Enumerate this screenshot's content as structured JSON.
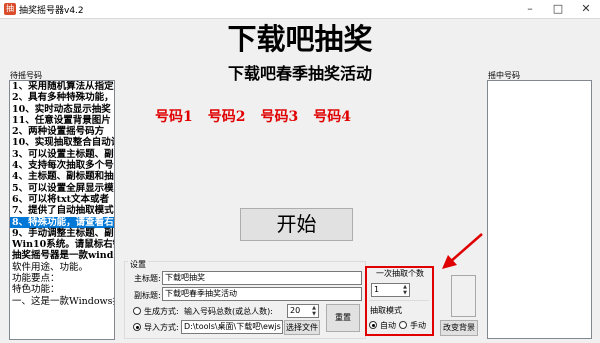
{
  "window": {
    "title": "抽奖摇号器v4.2",
    "icon": "app-icon"
  },
  "header": {
    "title": "下载吧抽奖",
    "subtitle": "下载吧春季抽奖活动"
  },
  "numbers": [
    "号码1",
    "号码2",
    "号码3",
    "号码4"
  ],
  "left_panel": {
    "label": "待摇号码",
    "lines": [
      "1、采用随机算法从指定",
      "2、具有多种特殊功能，",
      "10、实时动态显示抽奖",
      "11、任意设置背景图片",
      "2、两种设置摇号码方",
      "10、实现抽取整合自动计",
      "3、可以设置主标题、副",
      "4、支持每次抽取多个号",
      "4、主标题、副标题和抽",
      "5、可以设置全屏显示模",
      "6、可以将txt文本或者",
      "7、提供了自动抽取模式",
      "8、特殊功能，请查看右",
      "9、手动调整主标题、副",
      "Win10系统。请鼠标右键",
      "抽奖摇号器是一款wind",
      "   软件用途、功能。",
      "功能要点：",
      "特色功能：",
      "一、这是一款Windows抽"
    ],
    "selected_index": 12
  },
  "right_panel": {
    "label": "摇中号码"
  },
  "start_button": "开始",
  "settings": {
    "label": "设置",
    "main_title_label": "主标题:",
    "main_title_value": "下载吧抽奖",
    "sub_title_label": "副标题:",
    "sub_title_value": "下载吧春季抽奖活动",
    "generate_label": "生成方式:",
    "generate_hint": "输入号码总数(或总人数):",
    "total_value": "20",
    "import_label": "导入方式:",
    "import_path": "D:\\tools\\桌面\\下载吧\\ewjs",
    "choose_file": "选择文件",
    "reset": "重置",
    "generate_selected": false,
    "import_selected": true
  },
  "draw_panel": {
    "count_label": "一次抽取个数",
    "count_value": "1",
    "mode_label": "抽取模式",
    "auto_label": "自动",
    "manual_label": "手动",
    "auto_selected": true,
    "change_bg": "改变背景"
  },
  "colors": {
    "accent_red": "#e00000",
    "selection_blue": "#0078d7"
  }
}
